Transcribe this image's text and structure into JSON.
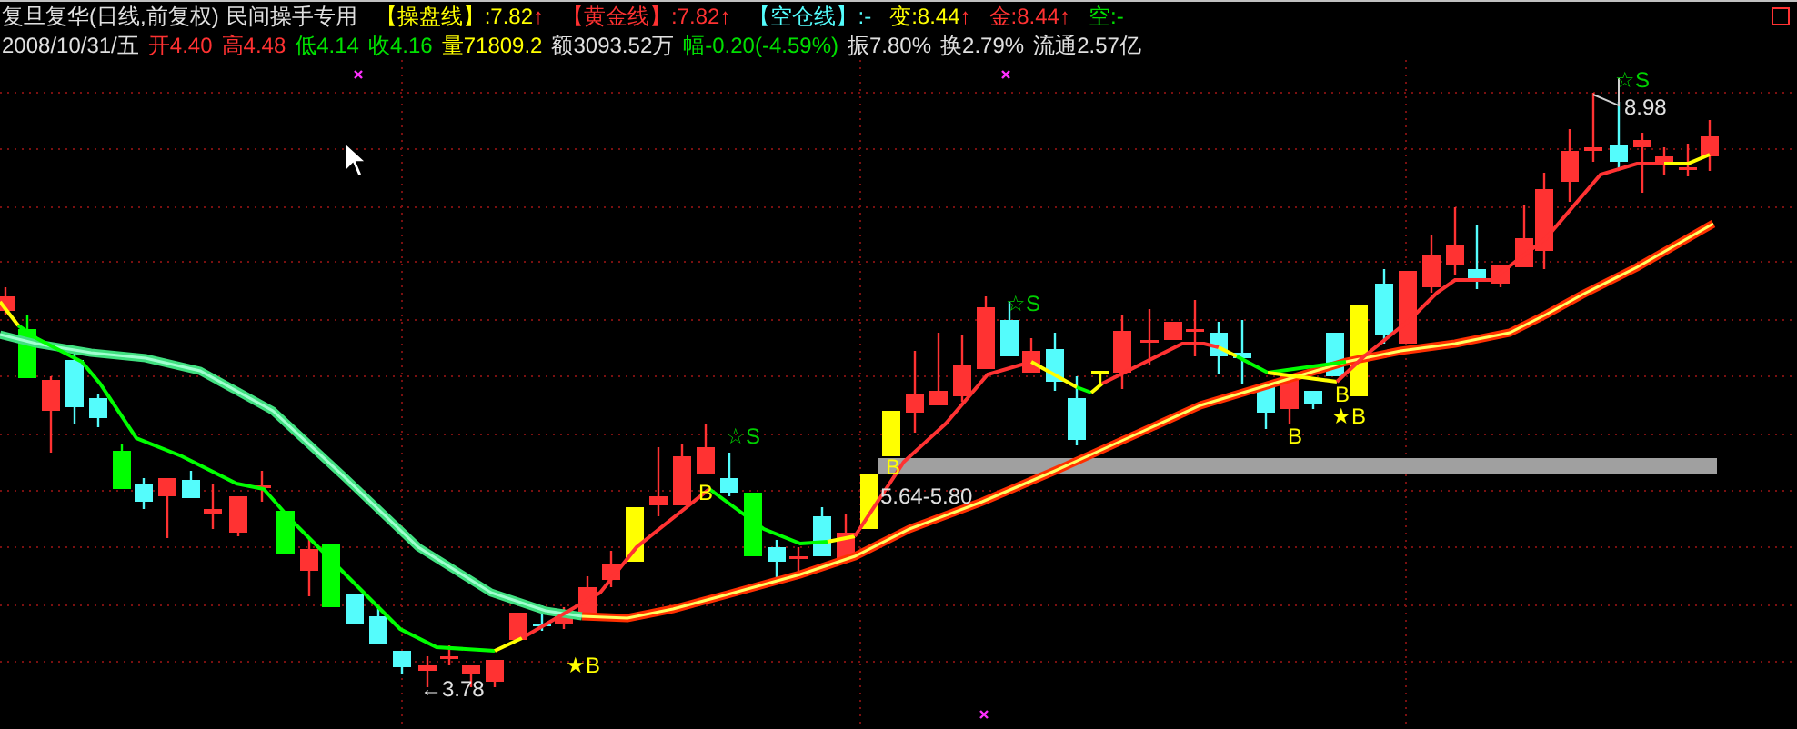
{
  "header": {
    "title": "复旦复华(日线,前复权)",
    "subtitle": "民间操手专用",
    "indicators": [
      {
        "label": "【操盘线】",
        "value": ":7.82",
        "arrow": "↑",
        "color": "#ffff00"
      },
      {
        "label": "【黄金线】",
        "value": ":7.82",
        "arrow": "↑",
        "color": "#ff3232"
      },
      {
        "label": "【空仓线】",
        "value": ":-",
        "color": "#54fcfc"
      },
      {
        "label": "变",
        "value": ":8.44",
        "arrow": "↑",
        "color": "#ffff00"
      },
      {
        "label": "金",
        "value": ":8.44",
        "arrow": "↑",
        "color": "#ff3232"
      },
      {
        "label": "空",
        "value": ":-",
        "color": "#00e000"
      }
    ]
  },
  "quote": {
    "date": "2008/10/31/五",
    "fields": [
      {
        "text": "开4.40",
        "color": "#ff3232"
      },
      {
        "text": "高4.48",
        "color": "#ff3232"
      },
      {
        "text": "低4.14",
        "color": "#00e000"
      },
      {
        "text": "收4.16",
        "color": "#00e000"
      },
      {
        "text": "量71809.2",
        "color": "#ffff00"
      },
      {
        "text": "额3093.52万",
        "color": "#e0e0e0"
      },
      {
        "text": "幅-0.20(-4.59%)",
        "color": "#00e000"
      },
      {
        "text": "振7.80%",
        "color": "#e0e0e0"
      },
      {
        "text": "换2.79%",
        "color": "#e0e0e0"
      },
      {
        "text": "流通2.57亿",
        "color": "#e0e0e0"
      }
    ]
  },
  "chart": {
    "labels": [
      {
        "text": "☆S",
        "kind": "sell"
      },
      {
        "text": "B",
        "kind": "buy"
      },
      {
        "text": "★B",
        "kind": "buy"
      },
      {
        "text": "←3.78",
        "kind": "price"
      },
      {
        "text": "B",
        "kind": "buy"
      },
      {
        "text": "5.64-5.80",
        "kind": "price"
      },
      {
        "text": "☆S",
        "kind": "sell"
      },
      {
        "text": "B",
        "kind": "buy"
      },
      {
        "text": "B",
        "kind": "buy"
      },
      {
        "text": "★B",
        "kind": "buy"
      },
      {
        "text": "☆S",
        "kind": "sell"
      },
      {
        "text": "8.98",
        "kind": "price"
      }
    ]
  }
}
